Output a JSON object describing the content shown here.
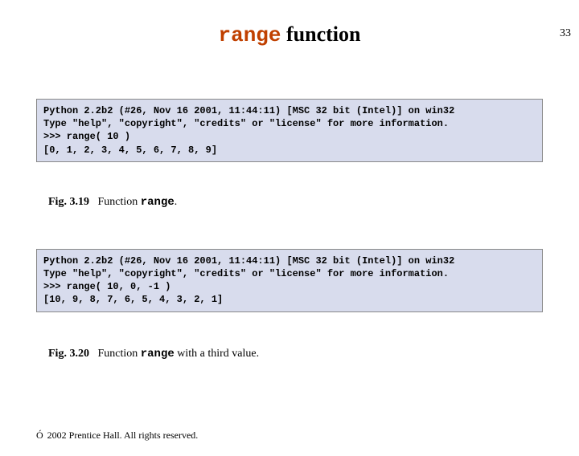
{
  "page_number": "33",
  "title": {
    "code_word": "range",
    "rest": " function"
  },
  "code1": {
    "line1": "Python 2.2b2 (#26, Nov 16 2001, 11:44:11) [MSC 32 bit (Intel)] on win32",
    "line2": "Type \"help\", \"copyright\", \"credits\" or \"license\" for more information.",
    "line3": ">>> range( 10 )",
    "line4": "[0, 1, 2, 3, 4, 5, 6, 7, 8, 9]"
  },
  "caption1": {
    "label": "Fig. 3.19",
    "pre": "Function ",
    "mono": "range",
    "post": "."
  },
  "code2": {
    "line1": "Python 2.2b2 (#26, Nov 16 2001, 11:44:11) [MSC 32 bit (Intel)] on win32",
    "line2": "Type \"help\", \"copyright\", \"credits\" or \"license\" for more information.",
    "line3": ">>> range( 10, 0, -1 )",
    "line4": "[10, 9, 8, 7, 6, 5, 4, 3, 2, 1]"
  },
  "caption2": {
    "label": "Fig. 3.20",
    "pre": "Function ",
    "mono": "range",
    "post": " with a third value."
  },
  "footer": {
    "symbol": "Ó",
    "text": " 2002 Prentice Hall. All rights reserved."
  }
}
